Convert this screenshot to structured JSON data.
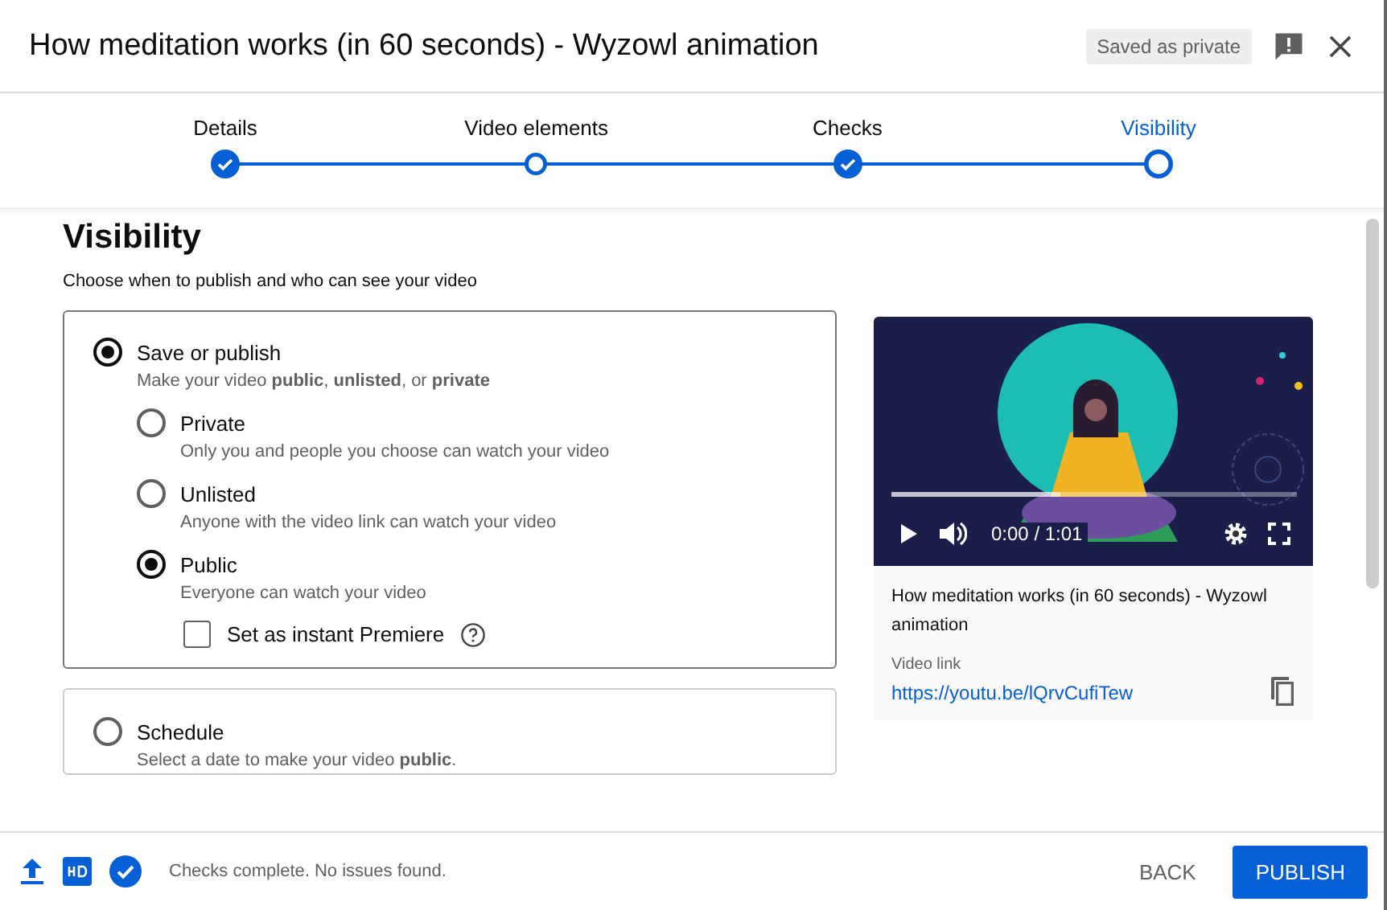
{
  "header": {
    "title": "How meditation works (in 60 seconds) - Wyzowl animation",
    "badge": "Saved as private"
  },
  "steps": [
    {
      "label": "Details",
      "completed": true,
      "selected": false
    },
    {
      "label": "Video elements",
      "completed": false,
      "selected": false
    },
    {
      "label": "Checks",
      "completed": true,
      "selected": false
    },
    {
      "label": "Visibility",
      "completed": false,
      "selected": true
    }
  ],
  "visibility": {
    "heading": "Visibility",
    "subtitle": "Choose when to publish and who can see your video",
    "save_or_publish": {
      "label": "Save or publish",
      "selected": true,
      "hint": "Make your video **public**, **unlisted**, or **private**",
      "options": [
        {
          "label": "Private",
          "hint": "Only you and people you choose can watch your video",
          "selected": false
        },
        {
          "label": "Unlisted",
          "hint": "Anyone with the video link can watch your video",
          "selected": false
        },
        {
          "label": "Public",
          "hint": "Everyone can watch your video",
          "selected": true
        }
      ],
      "premiere": {
        "label": "Set as instant Premiere",
        "checked": false
      }
    },
    "schedule": {
      "label": "Schedule",
      "selected": false,
      "hint": "Select a date to make your video **public**."
    }
  },
  "video": {
    "time": "0:00 / 1:01",
    "title": "How meditation works (in 60 seconds) - Wyzowl animation",
    "link_label": "Video link",
    "link": "https://youtu.be/lQrvCufiTew"
  },
  "footer": {
    "status": "Checks complete. No issues found.",
    "buttons": [
      "BACK",
      "PUBLISH"
    ]
  }
}
